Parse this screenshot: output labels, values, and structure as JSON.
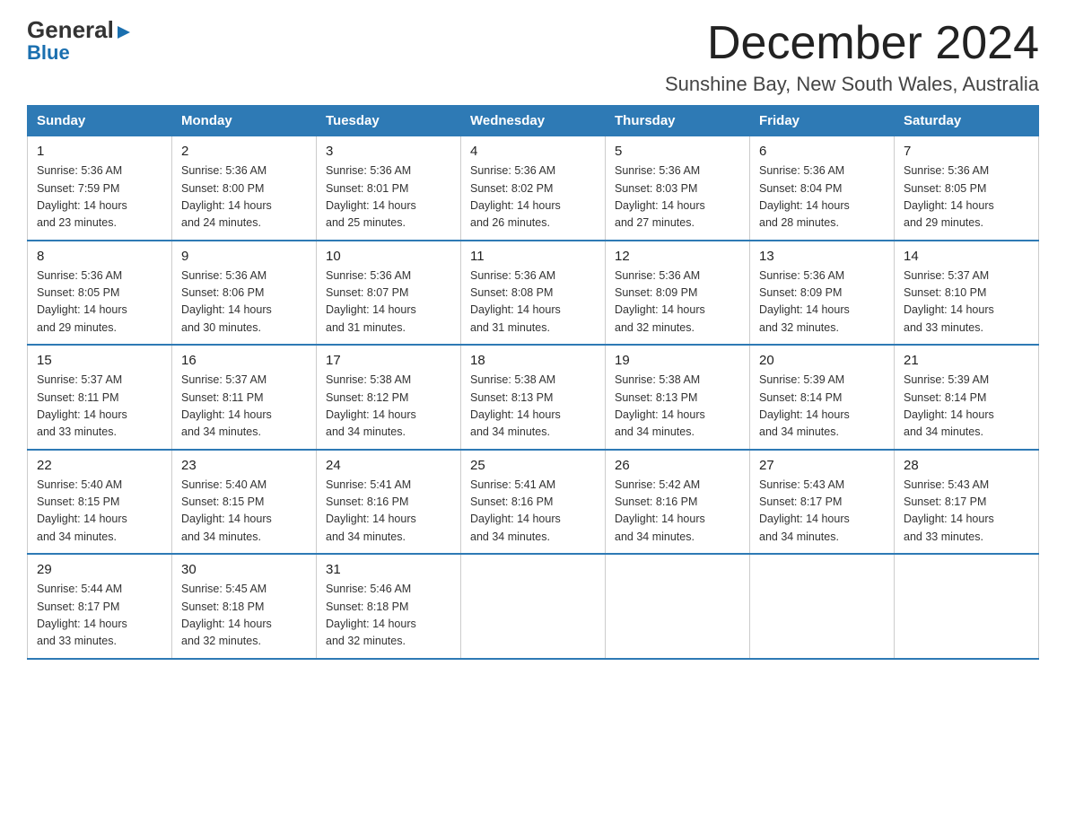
{
  "logo": {
    "general": "General",
    "blue": "Blue",
    "arrow_char": "▶"
  },
  "header": {
    "month_title": "December 2024",
    "location": "Sunshine Bay, New South Wales, Australia"
  },
  "days_of_week": [
    "Sunday",
    "Monday",
    "Tuesday",
    "Wednesday",
    "Thursday",
    "Friday",
    "Saturday"
  ],
  "weeks": [
    [
      {
        "num": "1",
        "sunrise": "5:36 AM",
        "sunset": "7:59 PM",
        "daylight": "14 hours and 23 minutes."
      },
      {
        "num": "2",
        "sunrise": "5:36 AM",
        "sunset": "8:00 PM",
        "daylight": "14 hours and 24 minutes."
      },
      {
        "num": "3",
        "sunrise": "5:36 AM",
        "sunset": "8:01 PM",
        "daylight": "14 hours and 25 minutes."
      },
      {
        "num": "4",
        "sunrise": "5:36 AM",
        "sunset": "8:02 PM",
        "daylight": "14 hours and 26 minutes."
      },
      {
        "num": "5",
        "sunrise": "5:36 AM",
        "sunset": "8:03 PM",
        "daylight": "14 hours and 27 minutes."
      },
      {
        "num": "6",
        "sunrise": "5:36 AM",
        "sunset": "8:04 PM",
        "daylight": "14 hours and 28 minutes."
      },
      {
        "num": "7",
        "sunrise": "5:36 AM",
        "sunset": "8:05 PM",
        "daylight": "14 hours and 29 minutes."
      }
    ],
    [
      {
        "num": "8",
        "sunrise": "5:36 AM",
        "sunset": "8:05 PM",
        "daylight": "14 hours and 29 minutes."
      },
      {
        "num": "9",
        "sunrise": "5:36 AM",
        "sunset": "8:06 PM",
        "daylight": "14 hours and 30 minutes."
      },
      {
        "num": "10",
        "sunrise": "5:36 AM",
        "sunset": "8:07 PM",
        "daylight": "14 hours and 31 minutes."
      },
      {
        "num": "11",
        "sunrise": "5:36 AM",
        "sunset": "8:08 PM",
        "daylight": "14 hours and 31 minutes."
      },
      {
        "num": "12",
        "sunrise": "5:36 AM",
        "sunset": "8:09 PM",
        "daylight": "14 hours and 32 minutes."
      },
      {
        "num": "13",
        "sunrise": "5:36 AM",
        "sunset": "8:09 PM",
        "daylight": "14 hours and 32 minutes."
      },
      {
        "num": "14",
        "sunrise": "5:37 AM",
        "sunset": "8:10 PM",
        "daylight": "14 hours and 33 minutes."
      }
    ],
    [
      {
        "num": "15",
        "sunrise": "5:37 AM",
        "sunset": "8:11 PM",
        "daylight": "14 hours and 33 minutes."
      },
      {
        "num": "16",
        "sunrise": "5:37 AM",
        "sunset": "8:11 PM",
        "daylight": "14 hours and 34 minutes."
      },
      {
        "num": "17",
        "sunrise": "5:38 AM",
        "sunset": "8:12 PM",
        "daylight": "14 hours and 34 minutes."
      },
      {
        "num": "18",
        "sunrise": "5:38 AM",
        "sunset": "8:13 PM",
        "daylight": "14 hours and 34 minutes."
      },
      {
        "num": "19",
        "sunrise": "5:38 AM",
        "sunset": "8:13 PM",
        "daylight": "14 hours and 34 minutes."
      },
      {
        "num": "20",
        "sunrise": "5:39 AM",
        "sunset": "8:14 PM",
        "daylight": "14 hours and 34 minutes."
      },
      {
        "num": "21",
        "sunrise": "5:39 AM",
        "sunset": "8:14 PM",
        "daylight": "14 hours and 34 minutes."
      }
    ],
    [
      {
        "num": "22",
        "sunrise": "5:40 AM",
        "sunset": "8:15 PM",
        "daylight": "14 hours and 34 minutes."
      },
      {
        "num": "23",
        "sunrise": "5:40 AM",
        "sunset": "8:15 PM",
        "daylight": "14 hours and 34 minutes."
      },
      {
        "num": "24",
        "sunrise": "5:41 AM",
        "sunset": "8:16 PM",
        "daylight": "14 hours and 34 minutes."
      },
      {
        "num": "25",
        "sunrise": "5:41 AM",
        "sunset": "8:16 PM",
        "daylight": "14 hours and 34 minutes."
      },
      {
        "num": "26",
        "sunrise": "5:42 AM",
        "sunset": "8:16 PM",
        "daylight": "14 hours and 34 minutes."
      },
      {
        "num": "27",
        "sunrise": "5:43 AM",
        "sunset": "8:17 PM",
        "daylight": "14 hours and 34 minutes."
      },
      {
        "num": "28",
        "sunrise": "5:43 AM",
        "sunset": "8:17 PM",
        "daylight": "14 hours and 33 minutes."
      }
    ],
    [
      {
        "num": "29",
        "sunrise": "5:44 AM",
        "sunset": "8:17 PM",
        "daylight": "14 hours and 33 minutes."
      },
      {
        "num": "30",
        "sunrise": "5:45 AM",
        "sunset": "8:18 PM",
        "daylight": "14 hours and 32 minutes."
      },
      {
        "num": "31",
        "sunrise": "5:46 AM",
        "sunset": "8:18 PM",
        "daylight": "14 hours and 32 minutes."
      },
      null,
      null,
      null,
      null
    ]
  ],
  "labels": {
    "sunrise": "Sunrise:",
    "sunset": "Sunset:",
    "daylight": "Daylight:"
  }
}
